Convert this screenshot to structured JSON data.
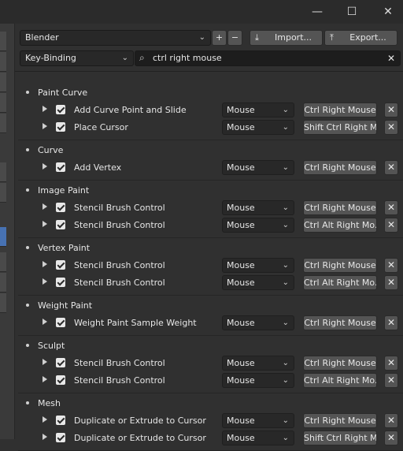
{
  "window": {
    "minimize": "—",
    "maximize": "☐",
    "close": "✕"
  },
  "header": {
    "preset": "Blender",
    "add": "+",
    "remove": "−",
    "import_label": "Import...",
    "export_label": "Export...",
    "search_mode": "Key-Binding",
    "search_value": "ctrl right mouse",
    "clear": "✕"
  },
  "categories": [
    {
      "label": "Paint Curve",
      "items": [
        {
          "label": "Add Curve Point and Slide",
          "type": "Mouse",
          "key": "Ctrl Right Mouse"
        },
        {
          "label": "Place Cursor",
          "type": "Mouse",
          "key": "Shift Ctrl Right M..."
        }
      ]
    },
    {
      "label": "Curve",
      "items": [
        {
          "label": "Add Vertex",
          "type": "Mouse",
          "key": "Ctrl Right Mouse"
        }
      ]
    },
    {
      "label": "Image Paint",
      "items": [
        {
          "label": "Stencil Brush Control",
          "type": "Mouse",
          "key": "Ctrl Right Mouse"
        },
        {
          "label": "Stencil Brush Control",
          "type": "Mouse",
          "key": "Ctrl Alt Right Mo..."
        }
      ]
    },
    {
      "label": "Vertex Paint",
      "items": [
        {
          "label": "Stencil Brush Control",
          "type": "Mouse",
          "key": "Ctrl Right Mouse"
        },
        {
          "label": "Stencil Brush Control",
          "type": "Mouse",
          "key": "Ctrl Alt Right Mo..."
        }
      ]
    },
    {
      "label": "Weight Paint",
      "items": [
        {
          "label": "Weight Paint Sample Weight",
          "type": "Mouse",
          "key": "Ctrl Right Mouse"
        }
      ]
    },
    {
      "label": "Sculpt",
      "items": [
        {
          "label": "Stencil Brush Control",
          "type": "Mouse",
          "key": "Ctrl Right Mouse"
        },
        {
          "label": "Stencil Brush Control",
          "type": "Mouse",
          "key": "Ctrl Alt Right Mo..."
        }
      ]
    },
    {
      "label": "Mesh",
      "items": [
        {
          "label": "Duplicate or Extrude to Cursor",
          "type": "Mouse",
          "key": "Ctrl Right Mouse"
        },
        {
          "label": "Duplicate or Extrude to Cursor",
          "type": "Mouse",
          "key": "Shift Ctrl Right M..."
        }
      ]
    }
  ]
}
